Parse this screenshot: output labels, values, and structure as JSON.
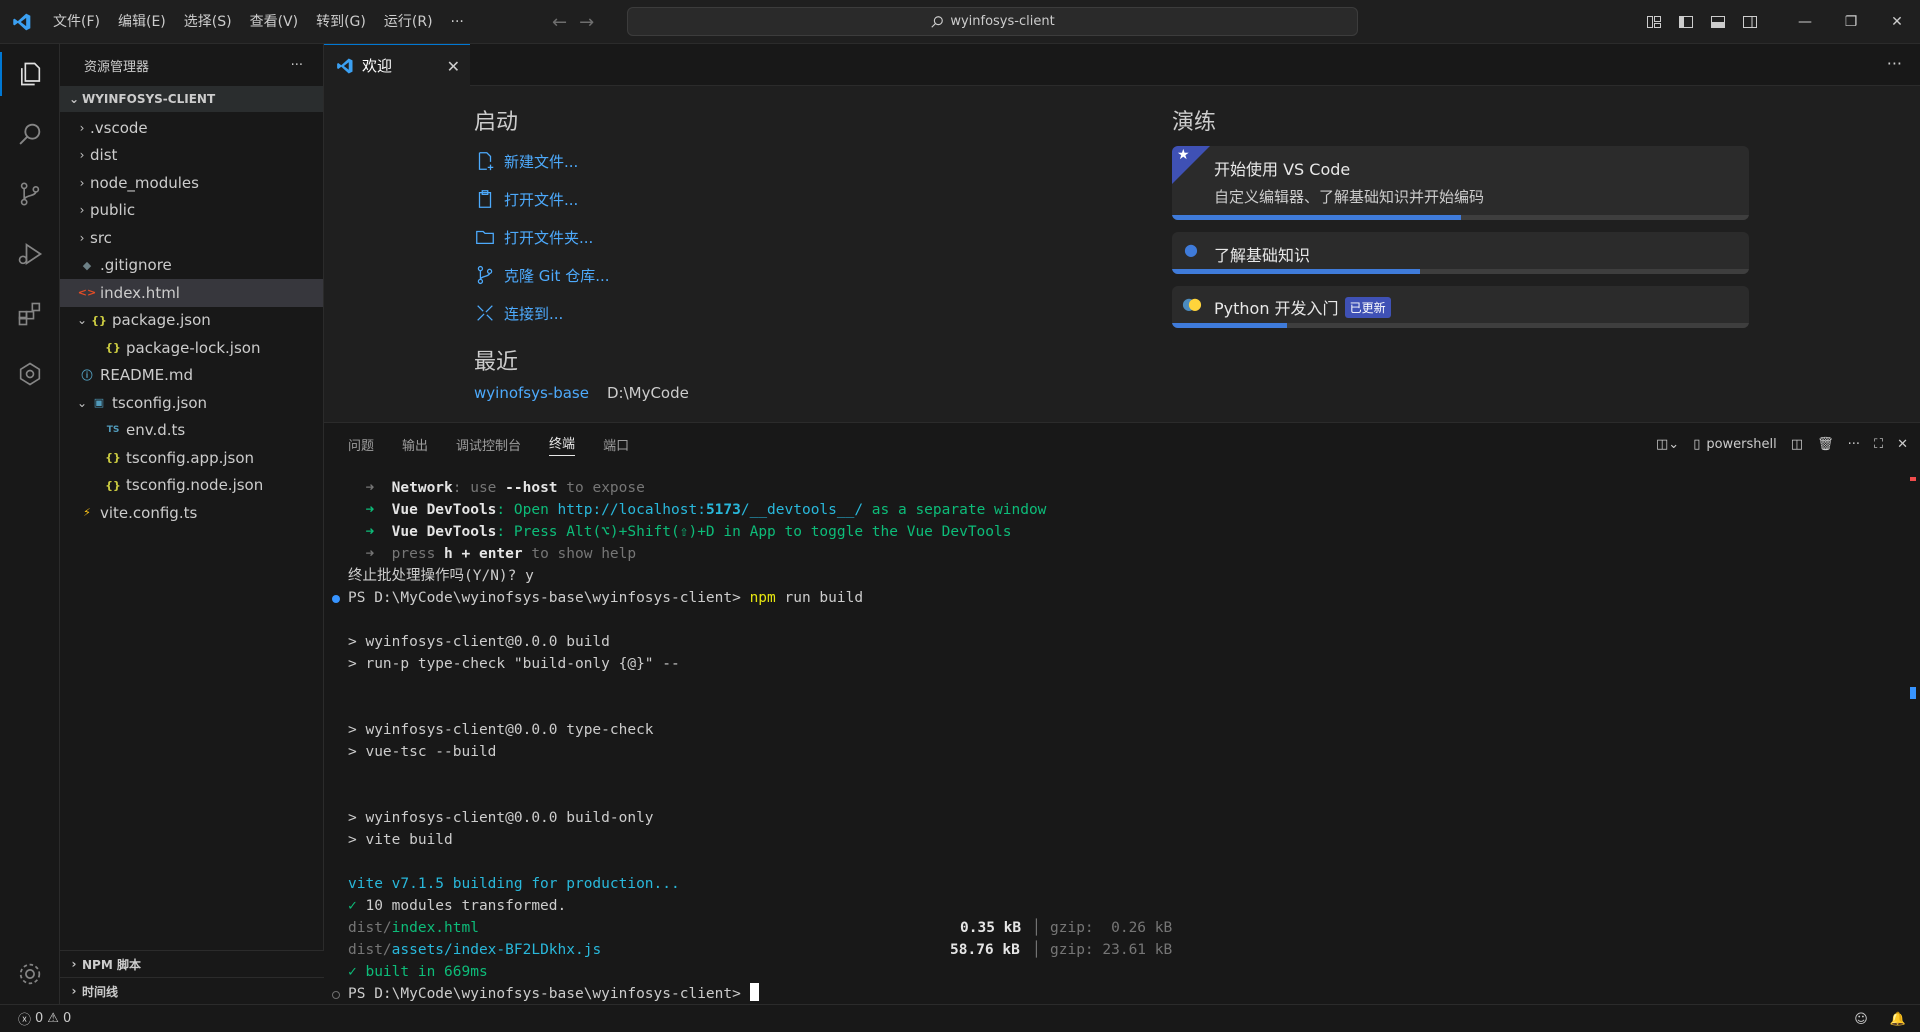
{
  "titlebar": {
    "menu": [
      "文件(F)",
      "编辑(E)",
      "选择(S)",
      "查看(V)",
      "转到(G)",
      "运行(R)",
      "···"
    ],
    "search_text": "wyinfosys-client"
  },
  "sidebar": {
    "title": "资源管理器",
    "more": "···",
    "section": "WYINFOSYS-CLIENT",
    "items": [
      {
        "label": ".vscode"
      },
      {
        "label": "dist"
      },
      {
        "label": "node_modules"
      },
      {
        "label": "public"
      },
      {
        "label": "src"
      },
      {
        "label": ".gitignore"
      },
      {
        "label": "index.html"
      },
      {
        "label": "package.json"
      },
      {
        "label": "package-lock.json"
      },
      {
        "label": "README.md"
      },
      {
        "label": "tsconfig.json"
      },
      {
        "label": "env.d.ts"
      },
      {
        "label": "tsconfig.app.json"
      },
      {
        "label": "tsconfig.node.json"
      },
      {
        "label": "vite.config.ts"
      }
    ],
    "bottom_sections": [
      "NPM 脚本",
      "时间线"
    ]
  },
  "editor": {
    "tab_label": "欢迎",
    "start_heading": "启动",
    "start_items": [
      "新建文件...",
      "打开文件...",
      "打开文件夹...",
      "克隆 Git 仓库...",
      "连接到..."
    ],
    "recent_heading": "最近",
    "recent": {
      "name": "wyinofsys-base",
      "path": "D:\\MyCode"
    },
    "walk_heading": "演练",
    "cards": [
      {
        "title": "开始使用 VS Code",
        "subtitle": "自定义编辑器、了解基础知识并开始编码",
        "progress": 0.5
      },
      {
        "title": "了解基础知识",
        "progress": 0.43
      },
      {
        "title": "Python 开发入门",
        "badge": "已更新",
        "progress": 0.2
      }
    ]
  },
  "panel": {
    "tabs": [
      "问题",
      "输出",
      "调试控制台",
      "终端",
      "端口"
    ],
    "active_tab": "终端",
    "shell": "powershell",
    "terminal": {
      "l1_label": "Network",
      "l1_a": ": use ",
      "l1_b": "--host",
      "l1_c": " to expose",
      "l2_label": "Vue DevTools",
      "l2_a": ": Open ",
      "l2_url": "http://localhost:",
      "l2_port": "5173",
      "l2_path": "/__devtools__/",
      "l2_c": " as a separate window",
      "l3_label": "Vue DevTools",
      "l3_a": ": Press Alt(⌥)+Shift(⇧)+D in App to toggle the Vue DevTools",
      "l4_a": "press ",
      "l4_b": "h + enter",
      "l4_c": " to show help",
      "l5": "终止批处理操作吗(Y/N)? y",
      "l6_prompt": "PS D:\\MyCode\\wyinofsys-base\\wyinfosys-client> ",
      "l6_cmd": "npm",
      "l6_args": " run build",
      "l7": "> wyinfosys-client@0.0.0 build",
      "l8": "> run-p type-check \"build-only {@}\" --",
      "l9": "> wyinfosys-client@0.0.0 type-check",
      "l10": "> vue-tsc --build",
      "l11": "> wyinfosys-client@0.0.0 build-only",
      "l12": "> vite build",
      "l13": "vite v7.1.5 building for production...",
      "l14_check": "✓",
      "l14": " 10 modules transformed.",
      "f1_dir": "dist/",
      "f1_name": "index.html",
      "f1_size": "0.35 kB",
      "f1_gzip": "gzip:  0.26 kB",
      "f2_dir": "dist/",
      "f2_sub": "assets/",
      "f2_name": "index-BF2LDkhx.js",
      "f2_size": "58.76 kB",
      "f2_gzip": "gzip: 23.61 kB",
      "l17_check": "✓",
      "l17": " built in 669ms",
      "l18_prompt": "PS D:\\MyCode\\wyinofsys-base\\wyinfosys-client> "
    }
  },
  "statusbar": {
    "errors": "0",
    "warnings": "0"
  }
}
